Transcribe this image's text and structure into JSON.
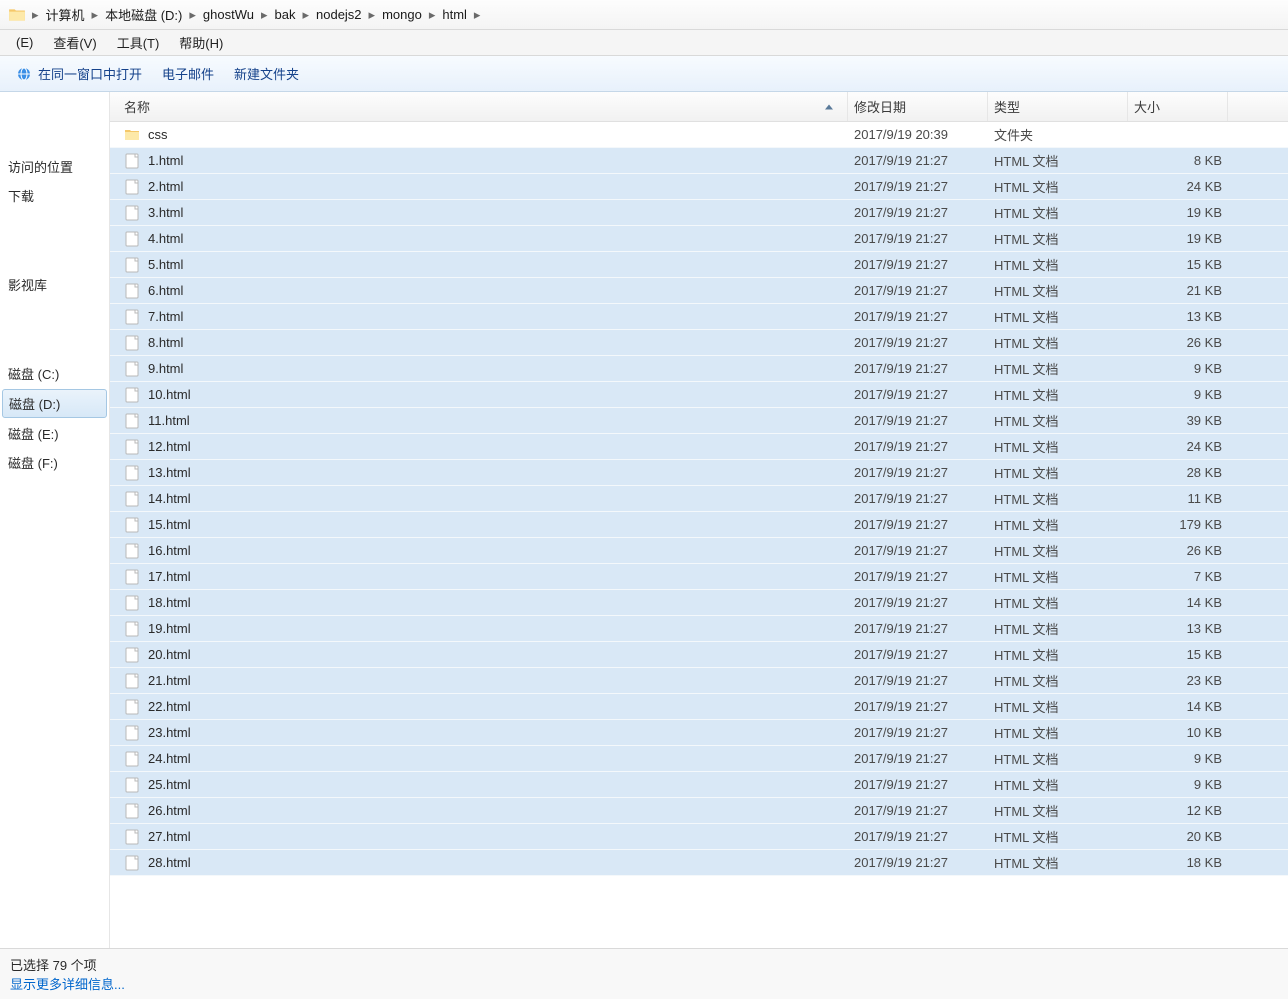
{
  "breadcrumb": {
    "items": [
      "计算机",
      "本地磁盘 (D:)",
      "ghostWu",
      "bak",
      "nodejs2",
      "mongo",
      "html"
    ]
  },
  "menubar": {
    "items": [
      "(E)",
      "查看(V)",
      "工具(T)",
      "帮助(H)"
    ]
  },
  "toolbar": {
    "open_same_window": "在同一窗口中打开",
    "email": "电子邮件",
    "new_folder": "新建文件夹"
  },
  "sidebar": {
    "items": [
      {
        "label": "",
        "gap": false
      },
      {
        "label": "访问的位置",
        "gap": false
      },
      {
        "label": "下载",
        "gap": false
      },
      {
        "label": "",
        "gap": true
      },
      {
        "label": "影视库",
        "gap": false
      },
      {
        "label": "",
        "gap": true
      },
      {
        "label": "磁盘 (C:)",
        "gap": false
      },
      {
        "label": "磁盘 (D:)",
        "gap": false,
        "selected": true
      },
      {
        "label": "磁盘 (E:)",
        "gap": false
      },
      {
        "label": "磁盘 (F:)",
        "gap": false
      }
    ]
  },
  "columns": {
    "name": "名称",
    "date": "修改日期",
    "type": "类型",
    "size": "大小"
  },
  "files": [
    {
      "name": "css",
      "date": "2017/9/19 20:39",
      "type": "文件夹",
      "size": "",
      "kind": "folder",
      "selected": false
    },
    {
      "name": "1.html",
      "date": "2017/9/19 21:27",
      "type": "HTML 文档",
      "size": "8 KB",
      "kind": "html",
      "selected": true
    },
    {
      "name": "2.html",
      "date": "2017/9/19 21:27",
      "type": "HTML 文档",
      "size": "24 KB",
      "kind": "html",
      "selected": true
    },
    {
      "name": "3.html",
      "date": "2017/9/19 21:27",
      "type": "HTML 文档",
      "size": "19 KB",
      "kind": "html",
      "selected": true
    },
    {
      "name": "4.html",
      "date": "2017/9/19 21:27",
      "type": "HTML 文档",
      "size": "19 KB",
      "kind": "html",
      "selected": true
    },
    {
      "name": "5.html",
      "date": "2017/9/19 21:27",
      "type": "HTML 文档",
      "size": "15 KB",
      "kind": "html",
      "selected": true
    },
    {
      "name": "6.html",
      "date": "2017/9/19 21:27",
      "type": "HTML 文档",
      "size": "21 KB",
      "kind": "html",
      "selected": true
    },
    {
      "name": "7.html",
      "date": "2017/9/19 21:27",
      "type": "HTML 文档",
      "size": "13 KB",
      "kind": "html",
      "selected": true
    },
    {
      "name": "8.html",
      "date": "2017/9/19 21:27",
      "type": "HTML 文档",
      "size": "26 KB",
      "kind": "html",
      "selected": true
    },
    {
      "name": "9.html",
      "date": "2017/9/19 21:27",
      "type": "HTML 文档",
      "size": "9 KB",
      "kind": "html",
      "selected": true
    },
    {
      "name": "10.html",
      "date": "2017/9/19 21:27",
      "type": "HTML 文档",
      "size": "9 KB",
      "kind": "html",
      "selected": true
    },
    {
      "name": "11.html",
      "date": "2017/9/19 21:27",
      "type": "HTML 文档",
      "size": "39 KB",
      "kind": "html",
      "selected": true
    },
    {
      "name": "12.html",
      "date": "2017/9/19 21:27",
      "type": "HTML 文档",
      "size": "24 KB",
      "kind": "html",
      "selected": true
    },
    {
      "name": "13.html",
      "date": "2017/9/19 21:27",
      "type": "HTML 文档",
      "size": "28 KB",
      "kind": "html",
      "selected": true
    },
    {
      "name": "14.html",
      "date": "2017/9/19 21:27",
      "type": "HTML 文档",
      "size": "11 KB",
      "kind": "html",
      "selected": true
    },
    {
      "name": "15.html",
      "date": "2017/9/19 21:27",
      "type": "HTML 文档",
      "size": "179 KB",
      "kind": "html",
      "selected": true
    },
    {
      "name": "16.html",
      "date": "2017/9/19 21:27",
      "type": "HTML 文档",
      "size": "26 KB",
      "kind": "html",
      "selected": true
    },
    {
      "name": "17.html",
      "date": "2017/9/19 21:27",
      "type": "HTML 文档",
      "size": "7 KB",
      "kind": "html",
      "selected": true
    },
    {
      "name": "18.html",
      "date": "2017/9/19 21:27",
      "type": "HTML 文档",
      "size": "14 KB",
      "kind": "html",
      "selected": true
    },
    {
      "name": "19.html",
      "date": "2017/9/19 21:27",
      "type": "HTML 文档",
      "size": "13 KB",
      "kind": "html",
      "selected": true
    },
    {
      "name": "20.html",
      "date": "2017/9/19 21:27",
      "type": "HTML 文档",
      "size": "15 KB",
      "kind": "html",
      "selected": true
    },
    {
      "name": "21.html",
      "date": "2017/9/19 21:27",
      "type": "HTML 文档",
      "size": "23 KB",
      "kind": "html",
      "selected": true
    },
    {
      "name": "22.html",
      "date": "2017/9/19 21:27",
      "type": "HTML 文档",
      "size": "14 KB",
      "kind": "html",
      "selected": true
    },
    {
      "name": "23.html",
      "date": "2017/9/19 21:27",
      "type": "HTML 文档",
      "size": "10 KB",
      "kind": "html",
      "selected": true
    },
    {
      "name": "24.html",
      "date": "2017/9/19 21:27",
      "type": "HTML 文档",
      "size": "9 KB",
      "kind": "html",
      "selected": true
    },
    {
      "name": "25.html",
      "date": "2017/9/19 21:27",
      "type": "HTML 文档",
      "size": "9 KB",
      "kind": "html",
      "selected": true
    },
    {
      "name": "26.html",
      "date": "2017/9/19 21:27",
      "type": "HTML 文档",
      "size": "12 KB",
      "kind": "html",
      "selected": true
    },
    {
      "name": "27.html",
      "date": "2017/9/19 21:27",
      "type": "HTML 文档",
      "size": "20 KB",
      "kind": "html",
      "selected": true
    },
    {
      "name": "28.html",
      "date": "2017/9/19 21:27",
      "type": "HTML 文档",
      "size": "18 KB",
      "kind": "html",
      "selected": true
    }
  ],
  "statusbar": {
    "line1": "已选择 79 个项",
    "line2": "显示更多详细信息..."
  }
}
